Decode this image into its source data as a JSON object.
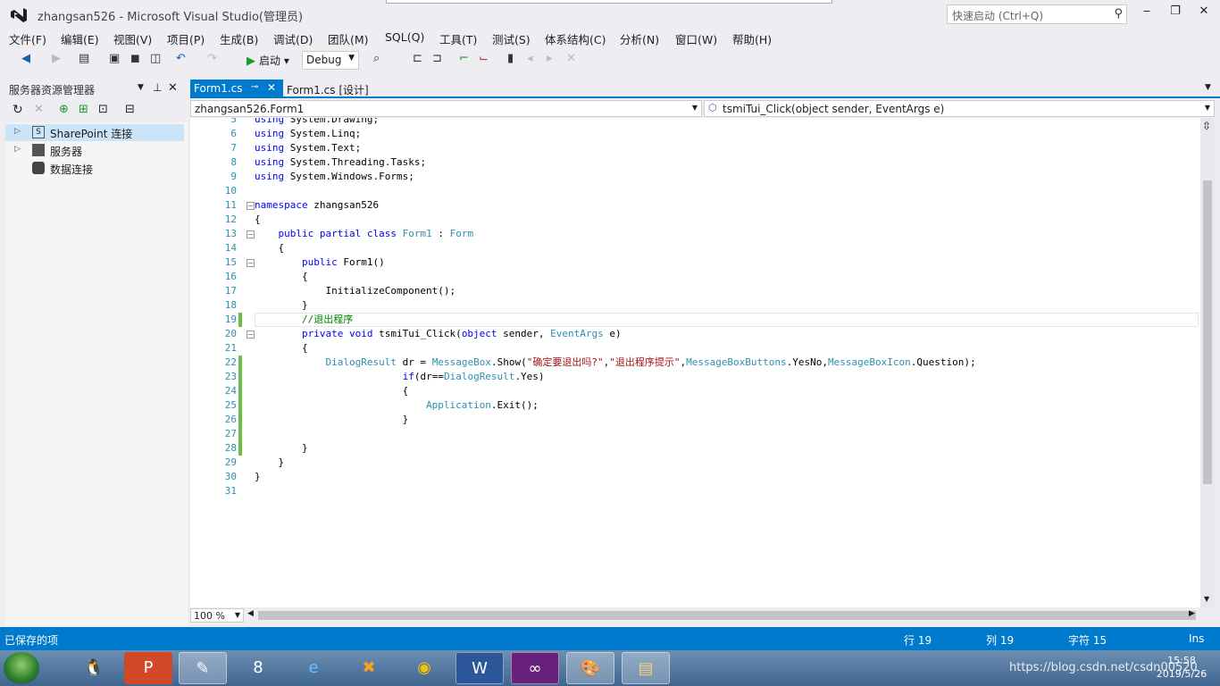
{
  "window": {
    "title": "zhangsan526 - Microsoft Visual Studio(管理员)",
    "quick_launch_placeholder": "快速启动 (Ctrl+Q)"
  },
  "menu": [
    "文件(F)",
    "编辑(E)",
    "视图(V)",
    "项目(P)",
    "生成(B)",
    "调试(D)",
    "团队(M)",
    "SQL(Q)",
    "工具(T)",
    "测试(S)",
    "体系结构(C)",
    "分析(N)",
    "窗口(W)",
    "帮助(H)"
  ],
  "toolbar": {
    "start_label": "启动",
    "config": "Debug"
  },
  "left_panel": {
    "title": "服务器资源管理器",
    "items": [
      {
        "label": "SharePoint 连接",
        "selected": true,
        "expandable": true,
        "icon": "S"
      },
      {
        "label": "服务器",
        "selected": false,
        "expandable": true,
        "icon": "server"
      },
      {
        "label": "数据连接",
        "selected": false,
        "expandable": false,
        "icon": "db"
      }
    ]
  },
  "tabs": [
    {
      "label": "Form1.cs",
      "active": true
    },
    {
      "label": "Form1.cs [设计]",
      "active": false
    }
  ],
  "nav": {
    "left": "zhangsan526.Form1",
    "right": "tsmiTui_Click(object sender, EventArgs e)"
  },
  "code": {
    "line_numbers": [
      "5",
      "6",
      "7",
      "8",
      "9",
      "10",
      "11",
      "12",
      "13",
      "14",
      "15",
      "16",
      "17",
      "18",
      "19",
      "20",
      "21",
      "22",
      "23",
      "24",
      "25",
      "26",
      "27",
      "28",
      "29",
      "30",
      "31"
    ],
    "changed_lines": [
      19,
      22,
      23,
      24,
      25,
      26,
      27,
      28
    ]
  },
  "bottom": {
    "zoom": "100 %"
  },
  "status": {
    "message": "已保存的项",
    "row": "行 19",
    "col": "列 19",
    "char": "字符 15",
    "mode": "Ins"
  },
  "taskbar": {
    "time": "15:58",
    "date": "2019/5/26",
    "watermark": "https://blog.csdn.net/csdn00520"
  },
  "colors": {
    "accent": "#007acc",
    "keyword": "#0000ff",
    "type": "#2b91af",
    "string": "#a31515",
    "comment": "#008000"
  }
}
